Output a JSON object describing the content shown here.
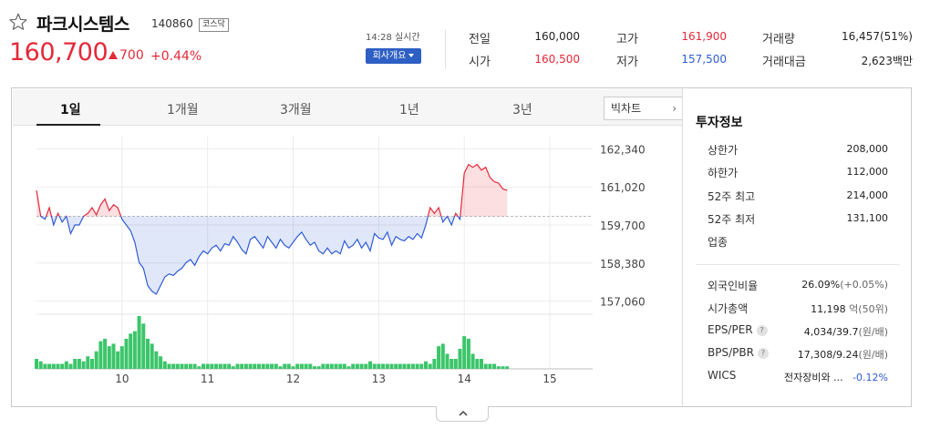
{
  "stock": {
    "name": "파크시스템스",
    "code": "140860",
    "market": "코스닥",
    "price": "160,700",
    "change": "700",
    "change_pct": "+0.44%"
  },
  "realtime": {
    "time": "14:28 실시간",
    "company_button": "회사개요"
  },
  "quote": {
    "prev_close_label": "전일",
    "prev_close": "160,000",
    "high_label": "고가",
    "high": "161,900",
    "volume_label": "거래량",
    "volume": "16,457(51%)",
    "open_label": "시가",
    "open": "160,500",
    "low_label": "저가",
    "low": "157,500",
    "amount_label": "거래대금",
    "amount": "2,623백만"
  },
  "tabs": [
    "1일",
    "1개월",
    "3개월",
    "1년",
    "3년"
  ],
  "big_chart_label": "빅차트",
  "colors": {
    "up": "#e42939",
    "down": "#2f5bd6",
    "volume": "#3cc56a"
  },
  "chart_data": {
    "type": "line",
    "reference": 160000,
    "y_ticks": [
      "162,340",
      "161,020",
      "159,700",
      "158,380",
      "157,060"
    ],
    "y_tick_values": [
      162340,
      161020,
      159700,
      158380,
      157060
    ],
    "ylim": [
      156700,
      162700
    ],
    "x_ticks": [
      "10",
      "11",
      "12",
      "13",
      "14",
      "15"
    ],
    "x_range": [
      9.0,
      15.5
    ],
    "series": [
      {
        "x": [
          9.0,
          9.05,
          9.1,
          9.15,
          9.2,
          9.25,
          9.3,
          9.35,
          9.4,
          9.45,
          9.5,
          9.55,
          9.6,
          9.65,
          9.7,
          9.75,
          9.8,
          9.85,
          9.9,
          9.95,
          10.0,
          10.05,
          10.1,
          10.15,
          10.2,
          10.25,
          10.3,
          10.35,
          10.4,
          10.45,
          10.5,
          10.55,
          10.6,
          10.65,
          10.7,
          10.75,
          10.8,
          10.85,
          10.9,
          10.95,
          11.0,
          11.05,
          11.1,
          11.15,
          11.2,
          11.25,
          11.3,
          11.35,
          11.4,
          11.45,
          11.5,
          11.55,
          11.6,
          11.65,
          11.7,
          11.75,
          11.8,
          11.85,
          11.9,
          11.95,
          12.0,
          12.05,
          12.1,
          12.15,
          12.2,
          12.25,
          12.3,
          12.35,
          12.4,
          12.45,
          12.5,
          12.55,
          12.6,
          12.65,
          12.7,
          12.75,
          12.8,
          12.85,
          12.9,
          12.95,
          13.0,
          13.05,
          13.1,
          13.15,
          13.2,
          13.25,
          13.3,
          13.35,
          13.4,
          13.45,
          13.5,
          13.55,
          13.6,
          13.65,
          13.7,
          13.75,
          13.8,
          13.85,
          13.9,
          13.95,
          14.0,
          14.05,
          14.1,
          14.15,
          14.2,
          14.25,
          14.3,
          14.35,
          14.4,
          14.45,
          14.5
        ],
        "y": [
          160900,
          160000,
          159900,
          160300,
          159700,
          160100,
          159800,
          160000,
          159400,
          159700,
          159700,
          160000,
          160100,
          160300,
          160050,
          160400,
          160600,
          160200,
          160400,
          160300,
          159900,
          159700,
          159500,
          159100,
          158400,
          158200,
          157600,
          157400,
          157300,
          157600,
          157900,
          158000,
          157950,
          158100,
          158200,
          158400,
          158500,
          158300,
          158600,
          158800,
          158700,
          158900,
          159000,
          158800,
          159050,
          159000,
          159300,
          159100,
          158850,
          158700,
          159200,
          159300,
          159100,
          158900,
          159300,
          159100,
          158900,
          159200,
          159000,
          158900,
          159100,
          159300,
          159450,
          159200,
          159000,
          159100,
          158800,
          158700,
          158900,
          158700,
          158800,
          158700,
          159150,
          158900,
          159000,
          159200,
          158900,
          159100,
          158800,
          159400,
          159250,
          159200,
          159450,
          159000,
          159300,
          159200,
          159150,
          159300,
          159200,
          159400,
          159250,
          159700,
          160300,
          160100,
          160300,
          159800,
          160000,
          159700,
          160100,
          159900,
          161500,
          161800,
          161700,
          161800,
          161600,
          161700,
          161350,
          161200,
          161150,
          160950,
          160900
        ]
      }
    ],
    "volume": [
      4,
      3,
      2,
      2,
      2,
      2,
      2,
      3,
      2,
      4,
      4,
      3,
      5,
      4,
      7,
      11,
      12,
      9,
      10,
      7,
      9,
      12,
      14,
      15,
      21,
      18,
      12,
      10,
      7,
      5,
      3,
      2,
      2,
      2,
      2,
      2,
      2,
      2,
      1,
      2,
      2,
      2,
      2,
      2,
      2,
      2,
      1,
      2,
      2,
      2,
      2,
      2,
      2,
      2,
      2,
      2,
      2,
      1,
      2,
      2,
      1,
      2,
      2,
      2,
      2,
      1,
      1,
      2,
      2,
      2,
      2,
      2,
      2,
      1,
      2,
      2,
      2,
      2,
      3,
      2,
      2,
      2,
      2,
      2,
      2,
      2,
      2,
      2,
      2,
      2,
      2,
      3,
      2,
      4,
      9,
      10,
      6,
      4,
      4,
      8,
      13,
      12,
      6,
      4,
      4,
      2,
      2,
      2,
      1,
      1,
      1
    ]
  },
  "invest": {
    "title": "투자정보",
    "upper_label": "상한가",
    "upper": "208,000",
    "lower_label": "하한가",
    "lower": "112,000",
    "high52_label": "52주 최고",
    "high52": "214,000",
    "low52_label": "52주 최저",
    "low52": "131,100",
    "sector_label": "업종",
    "foreign_label": "외국인비율",
    "foreign": "26.09%",
    "foreign_change": "(+0.05%)",
    "mcap_label": "시가총액",
    "mcap": "11,198",
    "mcap_unit": "억(50위)",
    "eps_label": "EPS/PER",
    "eps": "4,034/39.7",
    "eps_unit": "(원/배)",
    "bps_label": "BPS/PBR",
    "bps": "17,308/9.24",
    "bps_unit": "(원/배)",
    "wics_label": "WICS",
    "wics": "전자장비와 ...",
    "wics_change": "-0.12%"
  }
}
